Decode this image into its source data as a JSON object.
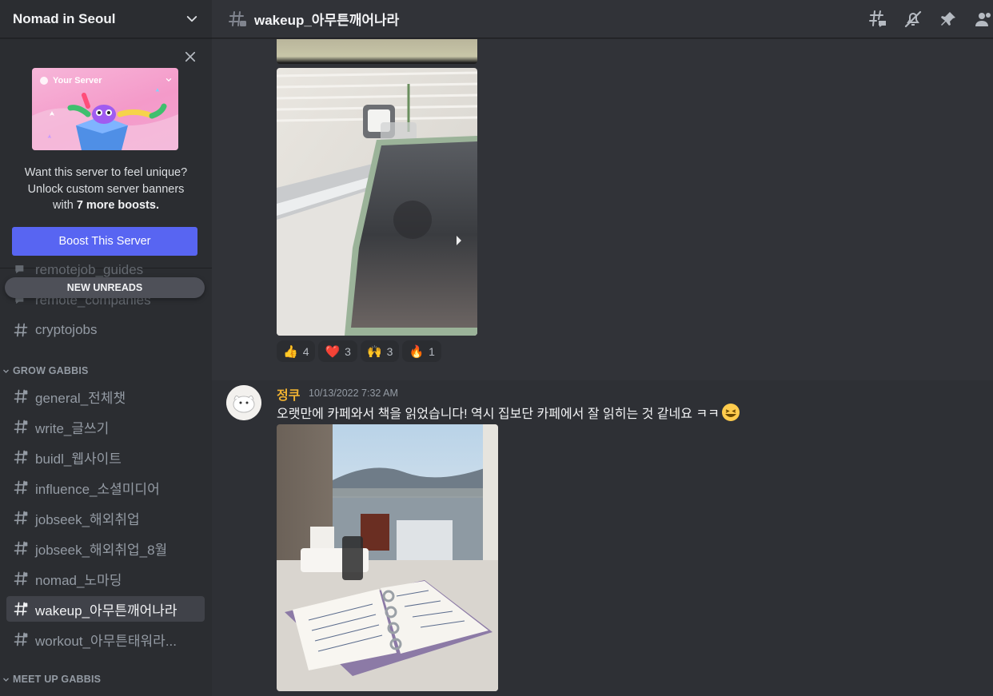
{
  "server": {
    "name": "Nomad in Seoul"
  },
  "boost": {
    "banner_label": "Your Server",
    "line1": "Want this server to feel unique?",
    "line2": "Unlock custom server banners",
    "line3_prefix": "with ",
    "line3_bold": "7 more boosts.",
    "button": "Boost This Server"
  },
  "sidebar": {
    "partial_channels": [
      "remotejob_guides",
      "remote_companies"
    ],
    "new_unreads": "NEW UNREADS",
    "channels_top": [
      "cryptojobs"
    ],
    "categories": [
      {
        "name": "GROW GABBIS"
      },
      {
        "name": "MEET UP GABBIS"
      }
    ],
    "grow_channels": [
      {
        "name": "general_전체챗"
      },
      {
        "name": "write_글쓰기"
      },
      {
        "name": "buidl_웹사이트"
      },
      {
        "name": "influence_소셜미디어"
      },
      {
        "name": "jobseek_해외취업"
      },
      {
        "name": "jobseek_해외취업_8월"
      },
      {
        "name": "nomad_노마딩"
      },
      {
        "name": "wakeup_아무튼깨어나라"
      },
      {
        "name": "workout_아무튼태워라..."
      }
    ],
    "active_channel": "wakeup_아무튼깨어나라"
  },
  "header": {
    "channel": "wakeup_아무튼깨어나라",
    "icons": [
      "threads-icon",
      "mute-icon",
      "pin-icon",
      "members-icon"
    ]
  },
  "messages": {
    "reactions": [
      {
        "emoji": "👍",
        "count": "4"
      },
      {
        "emoji": "❤️",
        "count": "3"
      },
      {
        "emoji": "🙌",
        "count": "3"
      },
      {
        "emoji": "🔥",
        "count": "1"
      }
    ],
    "second": {
      "author": "정쿠",
      "author_color": "#f0b232",
      "timestamp": "10/13/2022 7:32 AM",
      "text": "오랫만에 카페와서 책을 읽었습니다! 역시 집보단 카페에서 잘 읽히는 것 같네요 ㅋㅋ"
    }
  },
  "colors": {
    "accent": "#5865f2",
    "sidebar_bg": "#2b2d31",
    "chat_bg": "#313338",
    "active_channel_bg": "#404249"
  }
}
